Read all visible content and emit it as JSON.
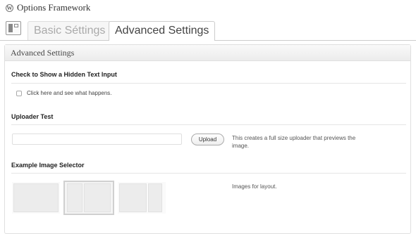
{
  "header": {
    "logo_icon": "wordpress-logo-icon",
    "title": "Options Framework"
  },
  "tabs": [
    {
      "label": "Basic Séttings",
      "active": false
    },
    {
      "label": "Advanced Settings",
      "active": true
    }
  ],
  "panel": {
    "title": "Advanced Settings",
    "sections": {
      "hidden_text": {
        "heading": "Check to Show a Hidden Text Input",
        "checkbox_label": "Click here and see what happens.",
        "checked": false
      },
      "uploader": {
        "heading": "Uploader Test",
        "input_value": "",
        "button_label": "Upload",
        "description_line1": "This creates a full size uploader that previews the",
        "description_line2": "image."
      },
      "image_selector": {
        "heading": "Example Image Selector",
        "description": "Images for layout.",
        "options": [
          {
            "name": "one-column",
            "selected": false
          },
          {
            "name": "two-columns",
            "selected": true
          },
          {
            "name": "three-columns",
            "selected": false
          }
        ]
      }
    }
  }
}
